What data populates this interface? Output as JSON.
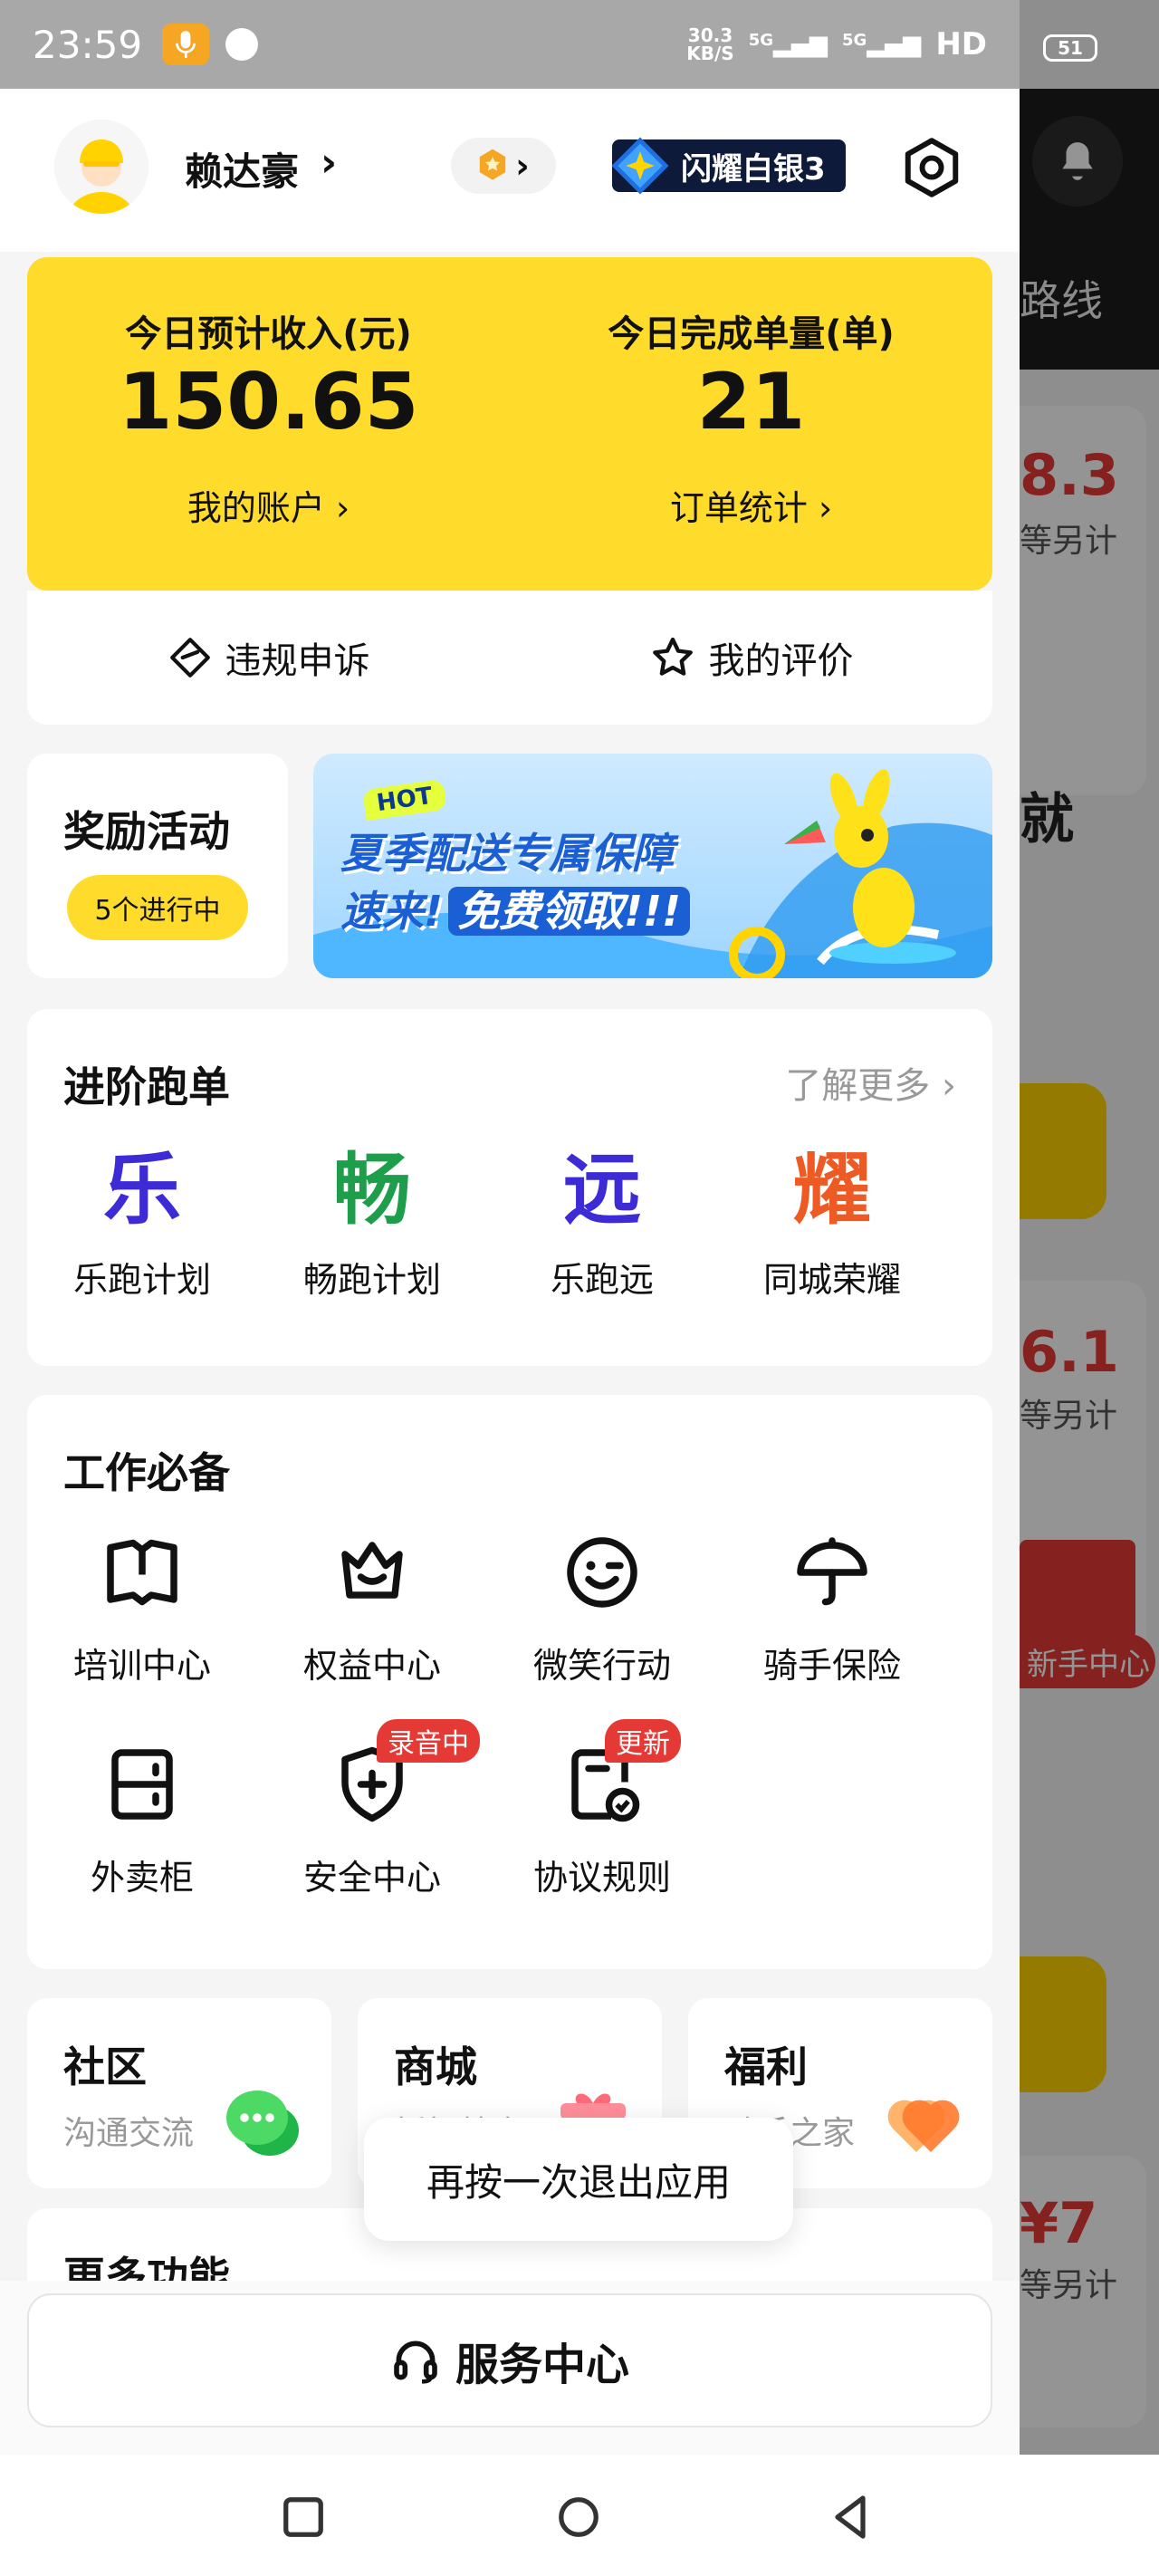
{
  "status_bar": {
    "time": "23:59",
    "net_speed_value": "30.3",
    "net_speed_unit": "KB/S",
    "signal_1": "5G",
    "signal_2": "5G",
    "hd": "HD",
    "battery": "51"
  },
  "background": {
    "route_text": "路线",
    "card1_amount": "8.3",
    "card1_text": "等另计",
    "card2_char": "就",
    "card3_amount": "6.1",
    "card3_text": "等另计",
    "newbie": "新手中心",
    "card4_amount": "¥7",
    "card4_text": "等另计"
  },
  "header": {
    "user_name": "赖达豪",
    "rank": "闪耀白银3"
  },
  "earnings": {
    "income_label": "今日预计收入(元)",
    "income_value": "150.65",
    "account_link": "我的账户 ›",
    "orders_label": "今日完成单量(单)",
    "orders_value": "21",
    "orders_link": "订单统计 ›",
    "appeal_label": "违规申诉",
    "review_label": "我的评价"
  },
  "rewards": {
    "title": "奖励活动",
    "pill": "5个进行中"
  },
  "banner": {
    "hot": "HOT",
    "line1": "夏季配送专属保障",
    "line2_a": "速来!",
    "line2_b": "免费领取!!!"
  },
  "advanced": {
    "title": "进阶跑单",
    "learn_more": "了解更多 ›",
    "items": [
      {
        "glyph": "乐",
        "label": "乐跑计划",
        "color": "#3d2bd6"
      },
      {
        "glyph": "畅",
        "label": "畅跑计划",
        "color": "#1e9e4a"
      },
      {
        "glyph": "远",
        "label": "乐跑远",
        "color": "#3d2bd6"
      },
      {
        "glyph": "耀",
        "label": "同城荣耀",
        "color": "#ee5a24"
      }
    ]
  },
  "work": {
    "title": "工作必备",
    "items": [
      {
        "label": "培训中心",
        "icon": "book-icon"
      },
      {
        "label": "权益中心",
        "icon": "crown-icon"
      },
      {
        "label": "微笑行动",
        "icon": "smile-icon"
      },
      {
        "label": "骑手保险",
        "icon": "umbrella-icon"
      },
      {
        "label": "外卖柜",
        "icon": "locker-icon"
      },
      {
        "label": "安全中心",
        "icon": "shield-icon",
        "tag": "录音中"
      },
      {
        "label": "协议规则",
        "icon": "document-check-icon",
        "tag": "更新"
      }
    ]
  },
  "mini_cards": [
    {
      "title": "社区",
      "sub": "沟通交流"
    },
    {
      "title": "商城",
      "sub": "折扣特惠"
    },
    {
      "title": "福利",
      "sub": "骑手之家"
    }
  ],
  "next_section": {
    "title": "更多功能"
  },
  "toast": "再按一次退出应用",
  "service": "服务中心"
}
